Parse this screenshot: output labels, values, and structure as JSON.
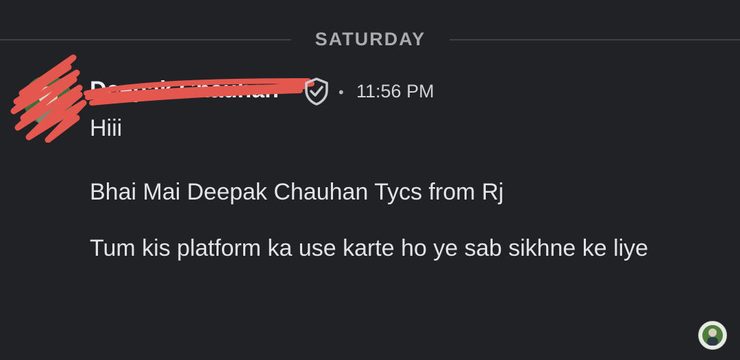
{
  "divider": {
    "label": "SATURDAY"
  },
  "message": {
    "author": "Deepak Chauhan",
    "author_badge_icon": "verified-shield-icon",
    "separator": "•",
    "time": "11:56 PM",
    "lines": [
      "Hiii",
      "Bhai Mai Deepak Chauhan Tycs from Rj",
      "Tum kis platform ka use karte ho ye sab sikhne ke liye"
    ]
  },
  "colors": {
    "background": "#202226",
    "divider_line": "#3e4147",
    "text": "#e2e4e7",
    "redaction": "#e4574f"
  }
}
